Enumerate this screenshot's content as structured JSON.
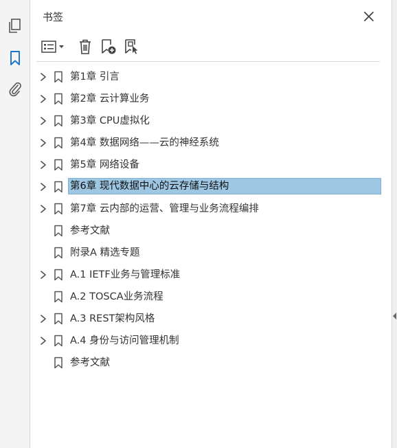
{
  "panel": {
    "title": "书签",
    "accent": "#1a73c8",
    "selection_color": "#9ec7e3"
  },
  "rail": {
    "icons": [
      "pages-icon",
      "bookmark-icon",
      "attachment-icon"
    ],
    "active": "bookmark-icon"
  },
  "toolbar": {
    "buttons": [
      "options-menu-icon",
      "delete-icon",
      "new-bookmark-icon",
      "new-bookmark-from-structure-icon"
    ]
  },
  "bookmarks": [
    {
      "label": "第1章 引言",
      "expandable": true,
      "selected": false
    },
    {
      "label": "第2章 云计算业务",
      "expandable": true,
      "selected": false
    },
    {
      "label": "第3章 CPU虚拟化",
      "expandable": true,
      "selected": false
    },
    {
      "label": "第4章 数据网络——云的神经系统",
      "expandable": true,
      "selected": false
    },
    {
      "label": "第5章 网络设备",
      "expandable": true,
      "selected": false
    },
    {
      "label": "第6章 现代数据中心的云存储与结构",
      "expandable": true,
      "selected": true
    },
    {
      "label": "第7章 云内部的运营、管理与业务流程编排",
      "expandable": true,
      "selected": false
    },
    {
      "label": "参考文献",
      "expandable": false,
      "selected": false
    },
    {
      "label": "附录A 精选专题",
      "expandable": false,
      "selected": false
    },
    {
      "label": "A.1 IETF业务与管理标准",
      "expandable": true,
      "selected": false
    },
    {
      "label": "A.2 TOSCA业务流程",
      "expandable": false,
      "selected": false
    },
    {
      "label": "A.3 REST架构风格",
      "expandable": true,
      "selected": false
    },
    {
      "label": "A.4 身份与访问管理机制",
      "expandable": true,
      "selected": false
    },
    {
      "label": "参考文献",
      "expandable": false,
      "selected": false
    }
  ]
}
